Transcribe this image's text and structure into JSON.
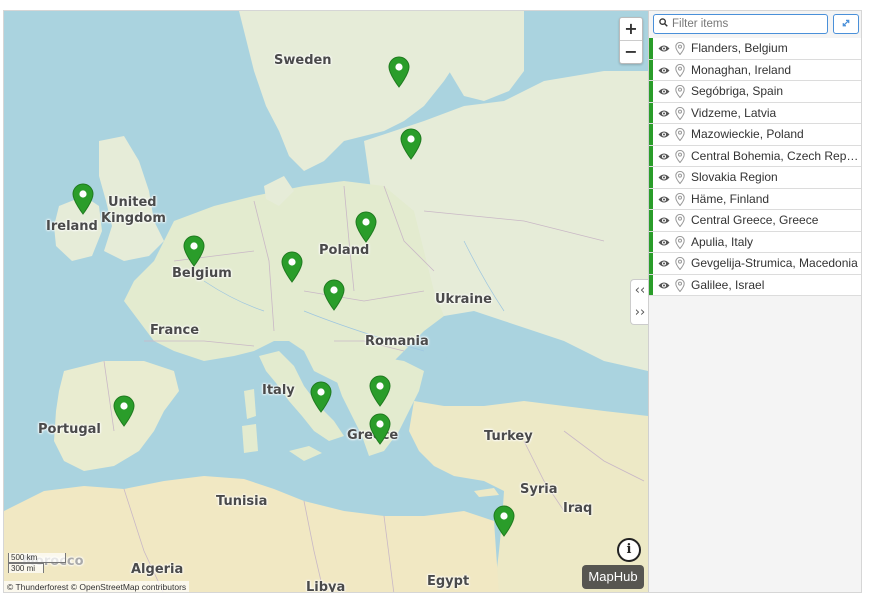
{
  "map": {
    "country_labels": [
      {
        "id": "sweden",
        "text": "Sweden"
      },
      {
        "id": "united-kingdom-1",
        "text": "United"
      },
      {
        "id": "united-kingdom-2",
        "text": "Kingdom"
      },
      {
        "id": "ireland",
        "text": "Ireland"
      },
      {
        "id": "belgium",
        "text": "Belgium"
      },
      {
        "id": "poland",
        "text": "Poland"
      },
      {
        "id": "ukraine",
        "text": "Ukraine"
      },
      {
        "id": "france",
        "text": "France"
      },
      {
        "id": "romania",
        "text": "Romania"
      },
      {
        "id": "italy",
        "text": "Italy"
      },
      {
        "id": "portugal",
        "text": "Portugal"
      },
      {
        "id": "greece",
        "text": "Greece"
      },
      {
        "id": "turkey",
        "text": "Turkey"
      },
      {
        "id": "tunisia",
        "text": "Tunisia"
      },
      {
        "id": "syria",
        "text": "Syria"
      },
      {
        "id": "iraq",
        "text": "Iraq"
      },
      {
        "id": "morocco",
        "text": "Morocco"
      },
      {
        "id": "algeria",
        "text": "Algeria"
      },
      {
        "id": "libya",
        "text": "Libya"
      },
      {
        "id": "egypt",
        "text": "Egypt"
      }
    ],
    "zoom_in_label": "+",
    "zoom_out_label": "−",
    "collapse_glyphs": [
      "‹‹",
      "››"
    ],
    "info_glyph": "i",
    "brand_label": "MapHub",
    "scale_km": "500 km",
    "scale_mi": "300 mi",
    "attribution": "© Thunderforest © OpenStreetMap contributors",
    "marker_color": "#2a9d2a"
  },
  "sidebar": {
    "filter_placeholder": "Filter items",
    "filter_value": "",
    "items": [
      {
        "label": "Flanders, Belgium"
      },
      {
        "label": "Monaghan, Ireland"
      },
      {
        "label": "Segóbriga, Spain"
      },
      {
        "label": "Vidzeme, Latvia"
      },
      {
        "label": "Mazowieckie, Poland"
      },
      {
        "label": "Central Bohemia, Czech Republic"
      },
      {
        "label": "Slovakia Region"
      },
      {
        "label": "Häme, Finland"
      },
      {
        "label": "Central Greece, Greece"
      },
      {
        "label": "Apulia, Italy"
      },
      {
        "label": "Gevgelija-Strumica, Macedonia"
      },
      {
        "label": "Galilee, Israel"
      }
    ]
  }
}
